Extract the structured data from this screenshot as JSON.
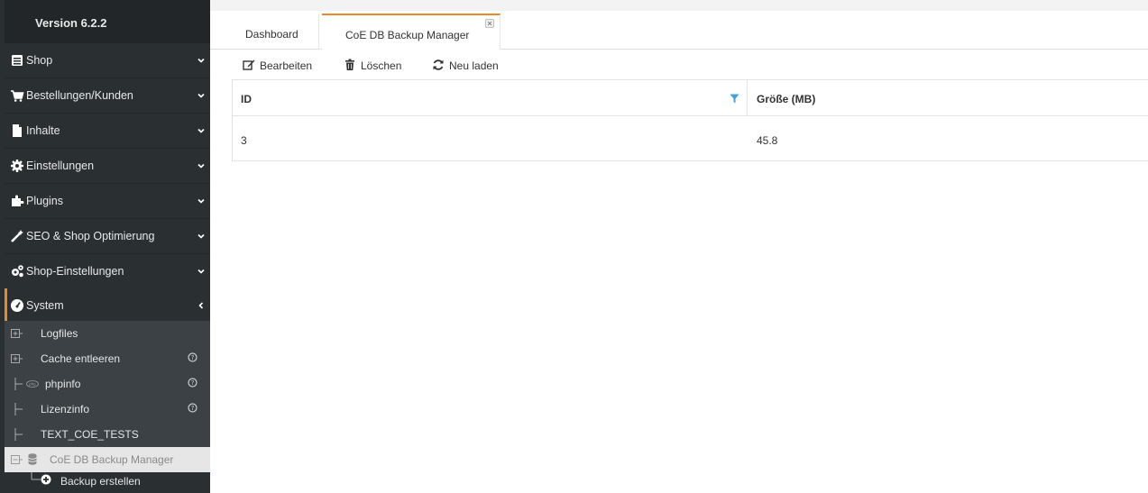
{
  "sidebar": {
    "version": "Version 6.2.2",
    "menu": [
      {
        "label": "Shop",
        "icon": "store-icon"
      },
      {
        "label": "Bestellungen/Kunden",
        "icon": "cart-icon"
      },
      {
        "label": "Inhalte",
        "icon": "document-icon"
      },
      {
        "label": "Einstellungen",
        "icon": "gear-icon"
      },
      {
        "label": "Plugins",
        "icon": "puzzle-icon"
      },
      {
        "label": "SEO & Shop Optimierung",
        "icon": "magic-wand-icon"
      },
      {
        "label": "Shop-Einstellungen",
        "icon": "cogs-icon"
      },
      {
        "label": "System",
        "icon": "dashboard-gauge-icon"
      }
    ],
    "system_sub": [
      {
        "label": "Logfiles"
      },
      {
        "label": "Cache entleeren"
      },
      {
        "label": "phpinfo"
      },
      {
        "label": "Lizenzinfo"
      },
      {
        "label": "TEXT_COE_TESTS"
      },
      {
        "label": "CoE DB Backup Manager"
      },
      {
        "label": "Backup erstellen"
      }
    ]
  },
  "tabs": [
    {
      "label": "Dashboard"
    },
    {
      "label": "CoE DB Backup Manager"
    }
  ],
  "toolbar": {
    "edit_label": "Bearbeiten",
    "delete_label": "Löschen",
    "reload_label": "Neu laden"
  },
  "grid": {
    "columns": [
      "ID",
      "Größe (MB)"
    ],
    "rows": [
      [
        "3",
        "45.8"
      ]
    ]
  },
  "colors": {
    "accent": "#e98a29",
    "sidebar_bg": "#2a2f32",
    "filter": "#3fa3d9"
  }
}
